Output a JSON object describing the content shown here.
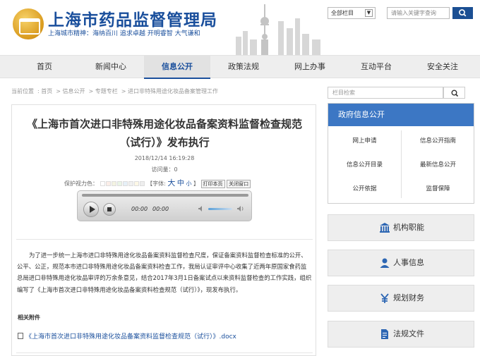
{
  "header": {
    "site_title": "上海市药品监督管理局",
    "slogan": "上海城市精神：海纳百川  追求卓越  开明睿智  大气谦和",
    "scope_select": "全部栏目",
    "search_placeholder": "请输入关键字查询"
  },
  "nav": [
    "首页",
    "新闻中心",
    "信息公开",
    "政策法规",
    "网上办事",
    "互动平台",
    "安全关注"
  ],
  "nav_active": "信息公开",
  "breadcrumb": [
    "当前位置",
    "首页",
    "信息公开",
    "专题专栏",
    "进口非特殊用途化妆品备案管理工作"
  ],
  "article": {
    "title_line1": "《上海市首次进口非特殊用途化妆品备案资料监督检查规范",
    "title_line2": "（试行）》发布执行",
    "date": "2018/12/14 16:19:28",
    "views_label": "访问量：",
    "views": "0",
    "eye_label": "保护视力色：",
    "font_label": "【字体:",
    "font_big": "大",
    "font_mid": "中",
    "font_small": "小",
    "font_close": "】",
    "print_btn": "打印本页",
    "close_btn": "关闭窗口",
    "time_current": "00:00",
    "time_total": "00:00",
    "body": "为了进一步统一上海市进口非特殊用途化妆品备案资料监督检查尺度，保证备案资料监督检查标准的公开、公平、公正，规范本市进口非特殊用途化妆品备案资料检查工作，我局认证审评中心收集了近两年原国家食药监总局进口非特殊用途化妆品审评的万余条意见，结合2017年3月1日备案试点以来资料监督检查的工作实践，组织编写了《上海市首次进口非特殊用途化妆品备案资料检查规范（试行）》，现发布执行。",
    "attach_label": "相关附件",
    "attach_link": "《上海市首次进口非特殊用途化妆品备案资料监督检查规范（试行）》.docx"
  },
  "sidebar": {
    "search_placeholder": "栏目检索",
    "gov_title": "政府信息公开",
    "gov_links": [
      "网上申请",
      "信息公开指南",
      "信息公开目录",
      "最新信息公开",
      "公开依据",
      "监督保障"
    ],
    "buttons": [
      {
        "label": "机构职能",
        "icon": "institution-icon"
      },
      {
        "label": "人事信息",
        "icon": "person-icon"
      },
      {
        "label": "规划财务",
        "icon": "yen-icon"
      },
      {
        "label": "法规文件",
        "icon": "document-icon"
      }
    ]
  },
  "colors": {
    "brand": "#1a4f9c",
    "panel_head": "#3c77c4",
    "nav_bg": "#eeeeee"
  }
}
